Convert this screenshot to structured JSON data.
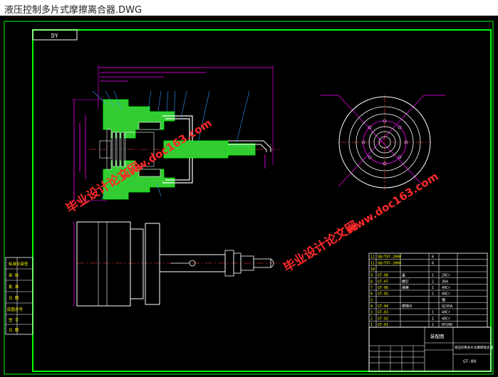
{
  "window": {
    "title": "液压控制多片式摩擦离合器.DWG"
  },
  "drawing": {
    "corner_label": "DY",
    "colors": {
      "frame": "#00ff00",
      "part": "#33cc33",
      "dim": "#ff00ff",
      "leader": "#3399ff",
      "watermark": "#ff2a2a"
    },
    "left_block": [
      "标准化审查",
      "审 核",
      "批 准",
      "日 期",
      "底图总号",
      "签 字",
      "日 期"
    ],
    "watermarks": [
      {
        "main": "毕业设计论文网",
        "url": "www.doc163.com"
      },
      {
        "main": "毕业设计论文网",
        "url": "www.doc163.com"
      }
    ],
    "bom": [
      {
        "no": "12",
        "code": "GB/T97-2000",
        "name": "",
        "qty": "6",
        "material": ""
      },
      {
        "no": "11",
        "code": "GB/T97-2000",
        "name": "",
        "qty": "6",
        "material": ""
      },
      {
        "no": "10",
        "code": "",
        "name": "",
        "qty": "",
        "material": ""
      },
      {
        "no": "9",
        "code": "GT-08",
        "name": "盖",
        "qty": "1",
        "material": "20Cr"
      },
      {
        "no": "8",
        "code": "GT-07",
        "name": "螺钉",
        "qty": "2",
        "material": "304"
      },
      {
        "no": "7",
        "code": "GT-06",
        "name": "弹簧",
        "qty": "1",
        "material": "40Cr"
      },
      {
        "no": "6",
        "code": "GT-05",
        "name": "",
        "qty": "1",
        "material": "40Cr"
      },
      {
        "no": "5",
        "code": "",
        "name": "",
        "qty": "",
        "material": "钢"
      },
      {
        "no": "4",
        "code": "GT-04",
        "name": "摩擦片",
        "qty": "",
        "material": "Q235A"
      },
      {
        "no": "3",
        "code": "GT-03",
        "name": "",
        "qty": "1",
        "material": "40Cr"
      },
      {
        "no": "2",
        "code": "GT-02",
        "name": "",
        "qty": "1",
        "material": "40Cr"
      },
      {
        "no": "1",
        "code": "GT-01",
        "name": "",
        "qty": "1",
        "material": "HT200"
      }
    ],
    "title_block": {
      "drawing_type": "装配图",
      "part_name": "液压控制多片式摩擦离合器",
      "drawing_no": "GT-00"
    }
  }
}
